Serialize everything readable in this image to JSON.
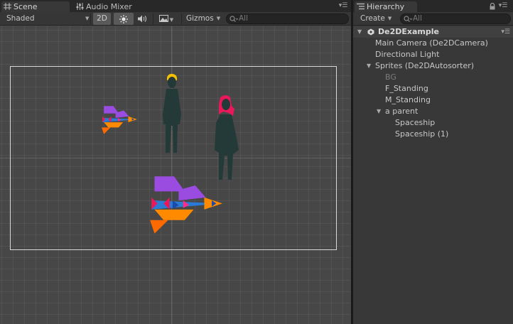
{
  "scene_tabs": [
    {
      "label": "Scene",
      "icon": "scene-grid-icon"
    },
    {
      "label": "Audio Mixer",
      "icon": "audio-mixer-icon"
    }
  ],
  "scene_toolbar": {
    "shading_mode": "Shaded",
    "mode_2d": "2D",
    "gizmos_label": "Gizmos",
    "search_placeholder": "All"
  },
  "hierarchy_tab": {
    "label": "Hierarchy",
    "icon": "hierarchy-list-icon"
  },
  "hierarchy_toolbar": {
    "create_label": "Create",
    "search_placeholder": "All"
  },
  "hierarchy": {
    "scene_name": "De2DExample",
    "items": [
      {
        "label": "Main Camera (De2DCamera)",
        "depth": 0,
        "foldout": "none"
      },
      {
        "label": "Directional Light",
        "depth": 0,
        "foldout": "none"
      },
      {
        "label": "Sprites (De2DAutosorter)",
        "depth": 0,
        "foldout": "expanded"
      },
      {
        "label": "BG",
        "depth": 1,
        "foldout": "none",
        "disabled": true
      },
      {
        "label": "F_Standing",
        "depth": 1,
        "foldout": "none"
      },
      {
        "label": "M_Standing",
        "depth": 1,
        "foldout": "none"
      },
      {
        "label": "a parent",
        "depth": 1,
        "foldout": "expanded"
      },
      {
        "label": "Spaceship",
        "depth": 2,
        "foldout": "none"
      },
      {
        "label": "Spaceship (1)",
        "depth": 2,
        "foldout": "none"
      }
    ]
  },
  "colors": {
    "spaceship_purple": "#9a4be0",
    "spaceship_orange": "#ff8a00",
    "spaceship_blue": "#2a7bd6",
    "figure_dark": "#243a38",
    "male_hair": "#f5c000",
    "female_hair": "#e8185a"
  }
}
